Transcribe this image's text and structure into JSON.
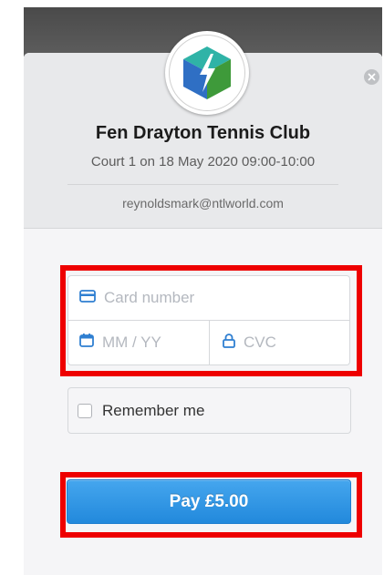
{
  "header": {
    "club_name": "Fen Drayton Tennis Club",
    "booking_details": "Court 1 on 18 May 2020 09:00-10:00",
    "email": "reynoldsmark@ntlworld.com"
  },
  "icons": {
    "logo": "bolt-cube-logo-icon",
    "close": "close-icon",
    "card": "credit-card-icon",
    "calendar": "calendar-icon",
    "lock": "lock-icon"
  },
  "form": {
    "card_number_placeholder": "Card number",
    "expiry_placeholder": "MM / YY",
    "cvc_placeholder": "CVC",
    "remember_label": "Remember me",
    "pay_label": "Pay £5.00"
  },
  "colors": {
    "accent": "#2f93e2",
    "highlight": "#ee0000",
    "icon_blue": "#2f7fd1"
  }
}
